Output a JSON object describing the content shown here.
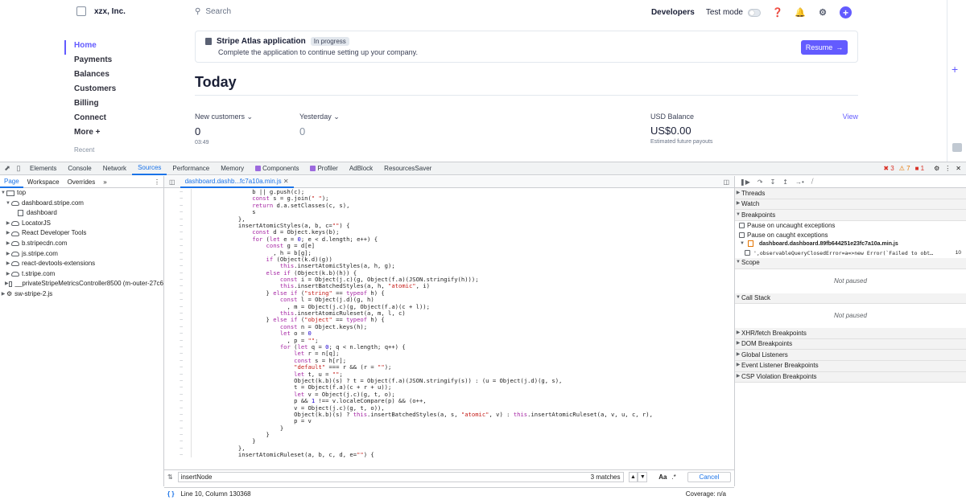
{
  "app": {
    "account_name": "xzx, Inc.",
    "search_placeholder": "Search",
    "developers_label": "Developers",
    "test_mode_label": "Test mode",
    "nav": [
      "Home",
      "Payments",
      "Balances",
      "Customers",
      "Billing",
      "Connect",
      "More +"
    ],
    "nav_recent": "Recent",
    "banner": {
      "title": "Stripe Atlas application",
      "badge": "In progress",
      "subtitle": "Complete the application to continue setting up your company.",
      "button": "Resume"
    },
    "today_title": "Today",
    "metrics": {
      "new_customers_label": "New customers",
      "new_customers_value": "0",
      "new_customers_time": "03:49",
      "yesterday_label": "Yesterday",
      "yesterday_value": "0",
      "balance_label": "USD Balance",
      "balance_value": "US$0.00",
      "balance_sub": "Estimated future payouts",
      "view_link": "View"
    }
  },
  "devtools": {
    "tabs": [
      "Elements",
      "Console",
      "Network",
      "Sources",
      "Performance",
      "Memory",
      "Components",
      "Profiler",
      "AdBlock",
      "ResourcesSaver"
    ],
    "active_tab": "Sources",
    "counts": {
      "errors": "3",
      "warnings": "7",
      "issues": "1"
    },
    "nav_subtabs": [
      "Page",
      "Workspace",
      "Overrides"
    ],
    "tree": [
      "top",
      "dashboard.stripe.com",
      "dashboard",
      "LocatorJS",
      "React Developer Tools",
      "b.stripecdn.com",
      "js.stripe.com",
      "react-devtools-extensions",
      "t.stripe.com",
      "__privateStripeMetricsController8500 (m-outer-27c6",
      "sw-stripe-2.js"
    ],
    "editor_tab": "dashboard.dashb...fc7a10a.min.js",
    "code_lines": [
      "                b || g.push(c);",
      "                const s = g.join(\" \");",
      "                return d.a.setClasses(c, s),",
      "                s",
      "            },",
      "            insertAtomicStyles(a, b, c=\"\") {",
      "                const d = Object.keys(b);",
      "                for (let e = 0; e < d.length; e++) {",
      "                    const g = d[e]",
      "                      , h = b[g];",
      "                    if (Object(k.d)(g))",
      "                        this.insertAtomicStyles(a, h, g);",
      "                    else if (Object(k.b)(h)) {",
      "                        const i = Object(j.c)(g, Object(f.a)(JSON.stringify(h)));",
      "                        this.insertBatchedStyles(a, h, \"atomic\", i)",
      "                    } else if (\"string\" == typeof h) {",
      "                        const l = Object(j.d)(g, h)",
      "                          , m = Object(j.c)(g, Object(f.a)(c + l));",
      "                        this.insertAtomicRuleset(a, m, l, c)",
      "                    } else if (\"object\" == typeof h) {",
      "                        const n = Object.keys(h);",
      "                        let o = 0",
      "                          , p = \"\";",
      "                        for (let q = 0; q < n.length; q++) {",
      "                            let r = n[q];",
      "                            const s = h[r];",
      "                            \"default\" === r && (r = \"\");",
      "                            let t, u = \"\";",
      "                            Object(k.b)(s) ? t = Object(f.a)(JSON.stringify(s)) : (u = Object(j.d)(g, s),",
      "                            t = Object(f.a)(c + r + u));",
      "                            let v = Object(j.c)(g, t, o);",
      "                            p && 1 !== v.localeCompare(p) && (o++,",
      "                            v = Object(j.c)(g, t, o)),",
      "                            Object(k.b)(s) ? this.insertBatchedStyles(a, s, \"atomic\", v) : this.insertAtomicRuleset(a, v, u, c, r),",
      "                            p = v",
      "                        }",
      "                    }",
      "                }",
      "            },",
      "            insertAtomicRuleset(a, b, c, d, e=\"\") {"
    ],
    "search_query": "insertNode",
    "search_matches": "3 matches",
    "search_case": "Aa",
    "search_regex": ".*",
    "cancel_label": "Cancel",
    "status_position": "Line 10, Column 130368",
    "coverage": "Coverage: n/a",
    "debug": {
      "threads": "Threads",
      "watch": "Watch",
      "breakpoints": "Breakpoints",
      "pause_uncaught": "Pause on uncaught exceptions",
      "pause_caught": "Pause on caught exceptions",
      "bp_file": "dashboard.dashboard.89fb644251e23fc7a10a.min.js",
      "bp_code": "',observableQueryClosedError=a=>new Error(`Failed to obt…",
      "bp_line_no": "10",
      "scope": "Scope",
      "scope_status": "Not paused",
      "call_stack": "Call Stack",
      "call_stack_status": "Not paused",
      "sections": [
        "XHR/fetch Breakpoints",
        "DOM Breakpoints",
        "Global Listeners",
        "Event Listener Breakpoints",
        "CSP Violation Breakpoints"
      ]
    }
  },
  "colors": {
    "accent": "#635bff",
    "devtools_blue": "#1a73e8",
    "error": "#d93025",
    "warning": "#e37400"
  }
}
